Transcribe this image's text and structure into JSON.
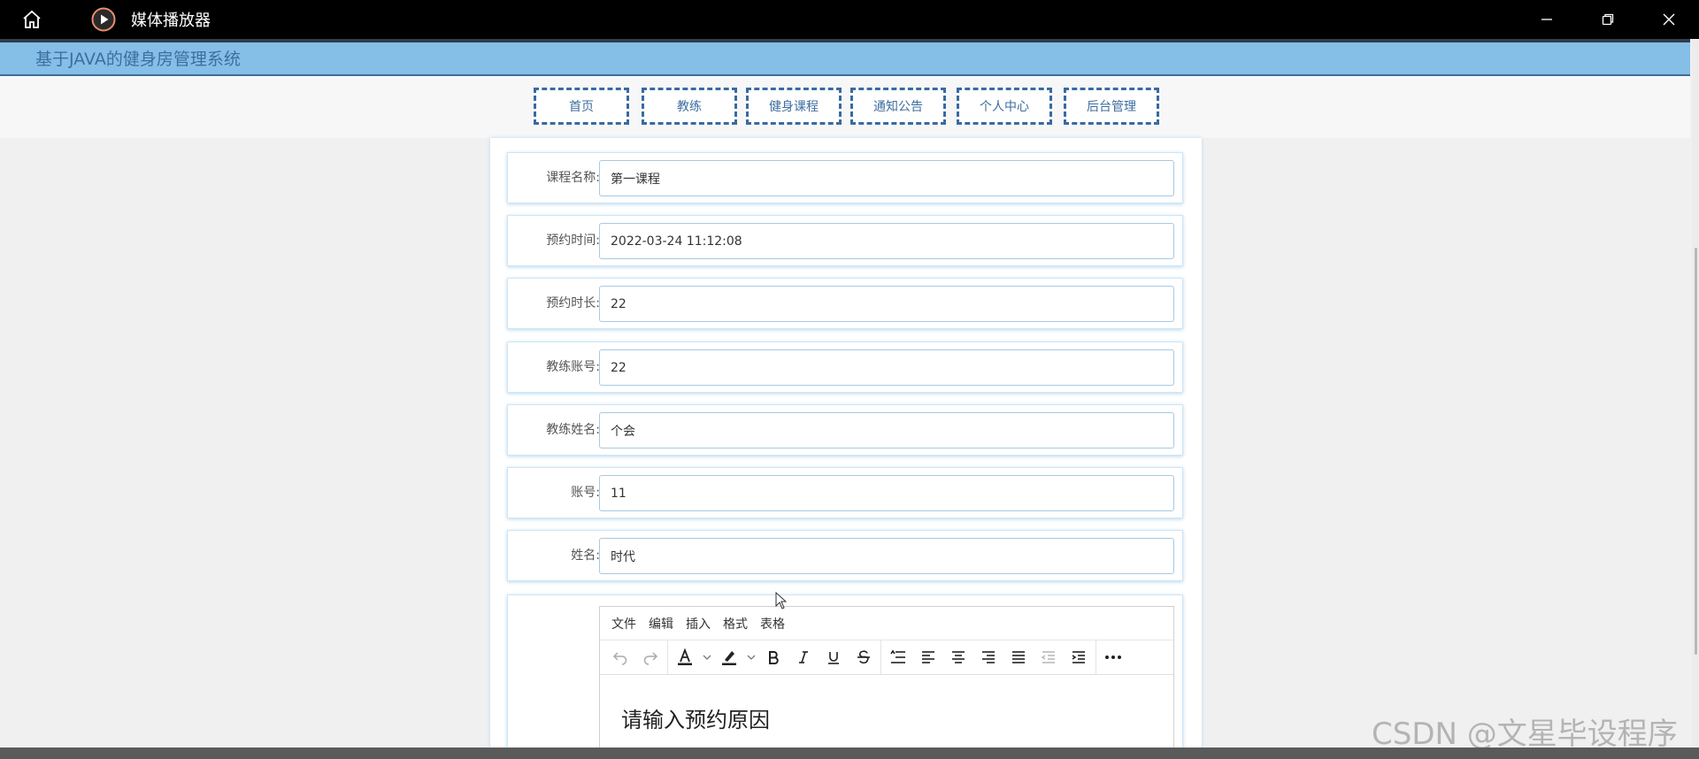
{
  "window": {
    "title": "媒体播放器",
    "icons": {
      "home": "home-icon",
      "logo": "play-icon",
      "minimize": "minimize-icon",
      "restore": "restore-icon",
      "close": "close-icon"
    }
  },
  "app": {
    "title": "基于JAVA的健身房管理系统"
  },
  "nav": {
    "items": [
      "首页",
      "教练",
      "健身课程",
      "通知公告",
      "个人中心",
      "后台管理"
    ]
  },
  "form": {
    "fields": [
      {
        "label": "课程名称:",
        "value": "第一课程"
      },
      {
        "label": "预约时间:",
        "value": "2022-03-24 11:12:08"
      },
      {
        "label": "预约时长:",
        "value": "22"
      },
      {
        "label": "教练账号:",
        "value": "22"
      },
      {
        "label": "教练姓名:",
        "value": "个会"
      },
      {
        "label": "账号:",
        "value": "11"
      },
      {
        "label": "姓名:",
        "value": "时代"
      }
    ]
  },
  "editor": {
    "menus": [
      "文件",
      "编辑",
      "插入",
      "格式",
      "表格"
    ],
    "placeholder": "请输入预约原因",
    "tools": [
      "undo-icon",
      "redo-icon",
      "font-color-icon",
      "highlight-icon",
      "bold-icon",
      "italic-icon",
      "underline-icon",
      "strikethrough-icon",
      "line-height-icon",
      "align-left-icon",
      "align-center-icon",
      "align-right-icon",
      "justify-icon",
      "outdent-icon",
      "indent-icon",
      "more-icon"
    ]
  },
  "watermark": "CSDN @文星毕设程序",
  "colors": {
    "header_bg": "#85bfe7",
    "nav_border": "#3a6aa0",
    "accent_text": "#3d6e9f"
  }
}
